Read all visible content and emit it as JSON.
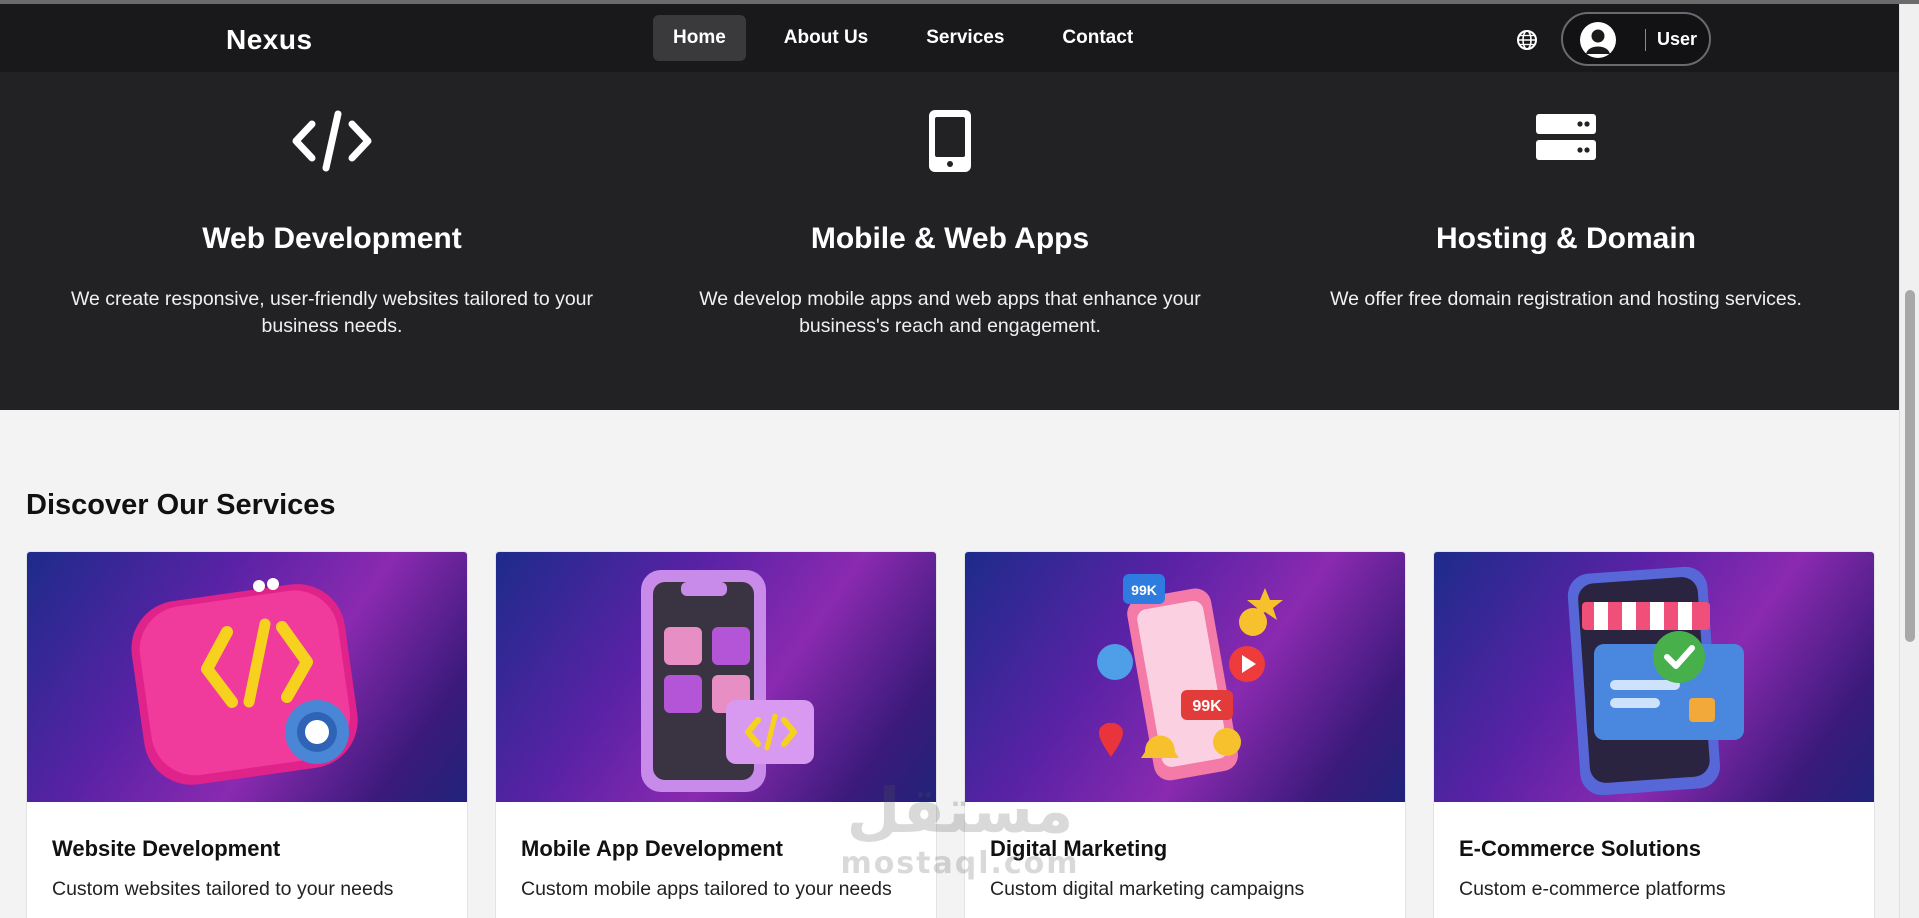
{
  "nav": {
    "logo": "Nexus",
    "links": [
      {
        "label": "Home",
        "active": true
      },
      {
        "label": "About Us",
        "active": false
      },
      {
        "label": "Services",
        "active": false
      },
      {
        "label": "Contact",
        "active": false
      }
    ],
    "user_label": "User",
    "globe_icon": "globe-icon",
    "avatar_icon": "user-avatar-icon"
  },
  "features": [
    {
      "icon": "code-icon",
      "title": "Web Development",
      "text": "We create responsive, user-friendly websites tailored to your business needs."
    },
    {
      "icon": "mobile-phone-icon",
      "title": "Mobile & Web Apps",
      "text": "We develop mobile apps and web apps that enhance your business's reach and engagement."
    },
    {
      "icon": "server-icon",
      "title": "Hosting & Domain",
      "text": "We offer free domain registration and hosting services."
    }
  ],
  "discover": {
    "title": "Discover Our Services",
    "cards": [
      {
        "title": "Website Development",
        "text": "Custom websites tailored to your needs",
        "image": "code-window-illustration"
      },
      {
        "title": "Mobile App Development",
        "text": "Custom mobile apps tailored to your needs",
        "image": "phone-app-illustration"
      },
      {
        "title": "Digital Marketing",
        "text": "Custom digital marketing campaigns",
        "image": "social-media-illustration"
      },
      {
        "title": "E-Commerce Solutions",
        "text": "Custom e-commerce platforms",
        "image": "online-shop-illustration"
      }
    ]
  },
  "watermark": {
    "arabic": "مستقل",
    "latin": "mostaql.com"
  },
  "colors": {
    "navbar_bg": "#19191b",
    "features_bg": "#222225",
    "page_bg": "#f3f3f4",
    "active_tab_bg": "#3a3a3d"
  }
}
